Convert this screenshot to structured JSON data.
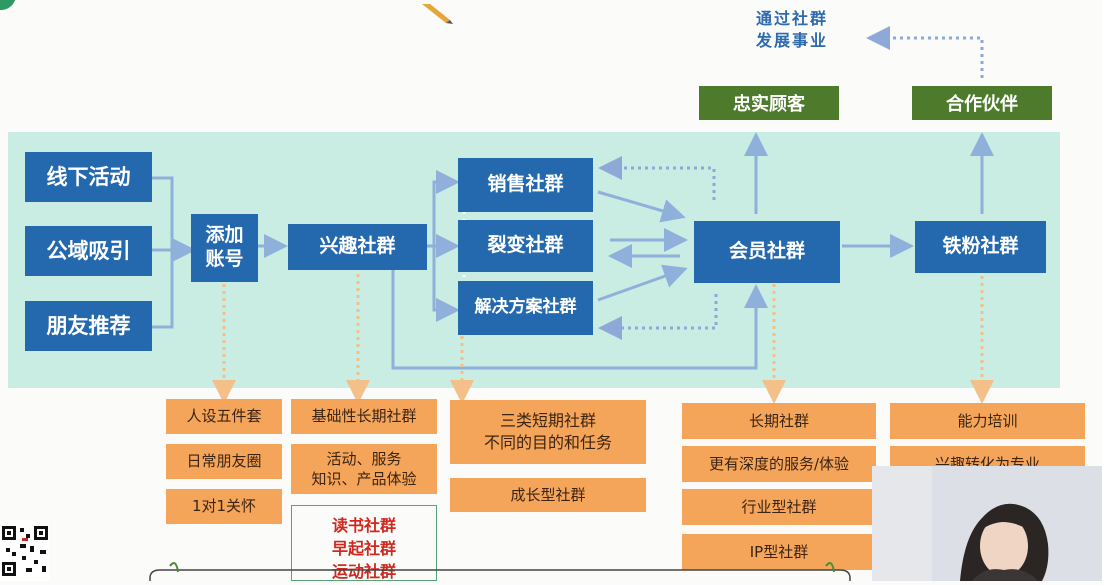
{
  "mission": {
    "line1": "通过社群",
    "line2": "发展事业"
  },
  "top_boxes": {
    "loyal": "忠实顾客",
    "partner": "合作伙伴"
  },
  "sources": {
    "offline": "线下活动",
    "public": "公域吸引",
    "friends": "朋友推荐"
  },
  "add_account": "添加账号",
  "interest": "兴趣社群",
  "short_groups": {
    "sales": "销售社群",
    "fission": "裂变社群",
    "solution": "解决方案社群"
  },
  "member": "会员社群",
  "fans": "铁粉社群",
  "details": {
    "col1": [
      "人设五件套",
      "日常朋友圈",
      "1对1关怀"
    ],
    "col2": [
      "基础性长期社群",
      "活动、服务\n知识、产品体验"
    ],
    "col2_red": [
      "读书社群",
      "早起社群",
      "运动社群"
    ],
    "col3": [
      "三类短期社群\n不同的目的和任务",
      "成长型社群"
    ],
    "col4": [
      "长期社群",
      "更有深度的服务/体验",
      "行业型社群",
      "IP型社群"
    ],
    "col5": [
      "能力培训",
      "兴趣转化为专业"
    ]
  },
  "colors": {
    "band": "#c9ece3",
    "blue": "#2468ae",
    "green": "#4e7a2c",
    "orange": "#f5a55a",
    "arrow": "#8fb0da",
    "dotted": "#5c86c4"
  }
}
